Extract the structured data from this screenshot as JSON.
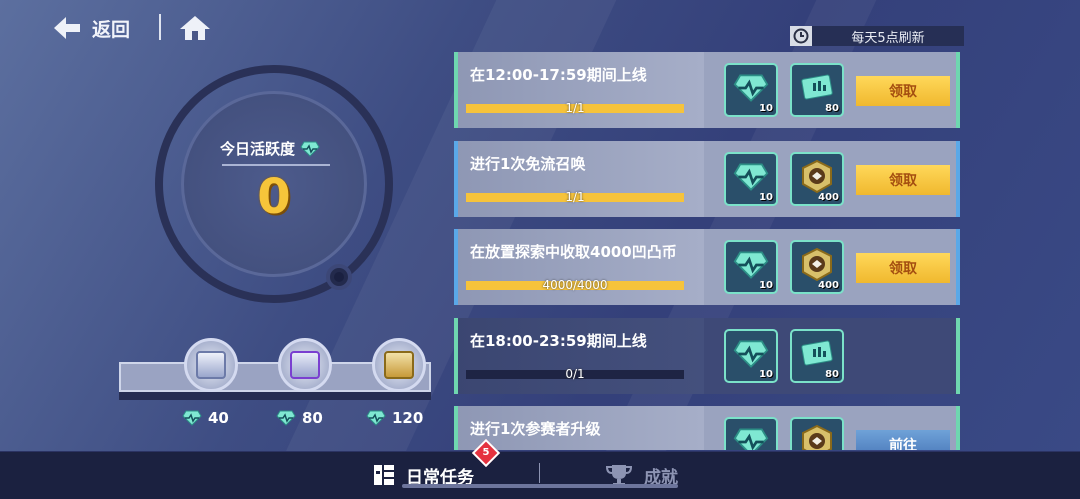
{
  "header": {
    "back_label": "返回",
    "refresh_text": "每天5点刷新"
  },
  "activity": {
    "label": "今日活跃度",
    "value": "0"
  },
  "chests": [
    {
      "requirement": "40",
      "tier": "silver"
    },
    {
      "requirement": "80",
      "tier": "purple"
    },
    {
      "requirement": "120",
      "tier": "gold"
    }
  ],
  "tasks": [
    {
      "title": "在12:00-17:59期间上线",
      "progress_text": "1/1",
      "progress": 1.0,
      "state": "done",
      "rewards": [
        {
          "icon": "activity-gem-icon",
          "qty": "10"
        },
        {
          "icon": "stamina-card-icon",
          "qty": "80"
        }
      ],
      "action": "领取"
    },
    {
      "title": "进行1次免流召唤",
      "progress_text": "1/1",
      "progress": 1.0,
      "state": "done",
      "rewards": [
        {
          "icon": "activity-gem-icon",
          "qty": "10"
        },
        {
          "icon": "coin-icon",
          "qty": "400"
        }
      ],
      "action": "领取"
    },
    {
      "title": "在放置探索中收取4000凹凸币",
      "progress_text": "4000/4000",
      "progress": 1.0,
      "state": "done",
      "rewards": [
        {
          "icon": "activity-gem-icon",
          "qty": "10"
        },
        {
          "icon": "coin-icon",
          "qty": "400"
        }
      ],
      "action": "领取"
    },
    {
      "title": "在18:00-23:59期间上线",
      "progress_text": "0/1",
      "progress": 0.0,
      "state": "pending",
      "rewards": [
        {
          "icon": "activity-gem-icon",
          "qty": "10"
        },
        {
          "icon": "stamina-card-icon",
          "qty": "80"
        }
      ],
      "action": ""
    },
    {
      "title": "进行1次参赛者升级",
      "progress_text": "",
      "progress": 0.0,
      "state": "done",
      "rewards": [
        {
          "icon": "activity-gem-icon",
          "qty": ""
        },
        {
          "icon": "coin-icon",
          "qty": ""
        }
      ],
      "action": "前往"
    }
  ],
  "nav": {
    "daily_label": "日常任务",
    "achievement_label": "成就",
    "badge_count": "5"
  },
  "colors": {
    "accent_gold": "#f6c33b",
    "claim_button": "#ffd85a",
    "go_button": "#4876b8",
    "badge_red": "#e5323f",
    "reward_border": "#7be2c9"
  }
}
